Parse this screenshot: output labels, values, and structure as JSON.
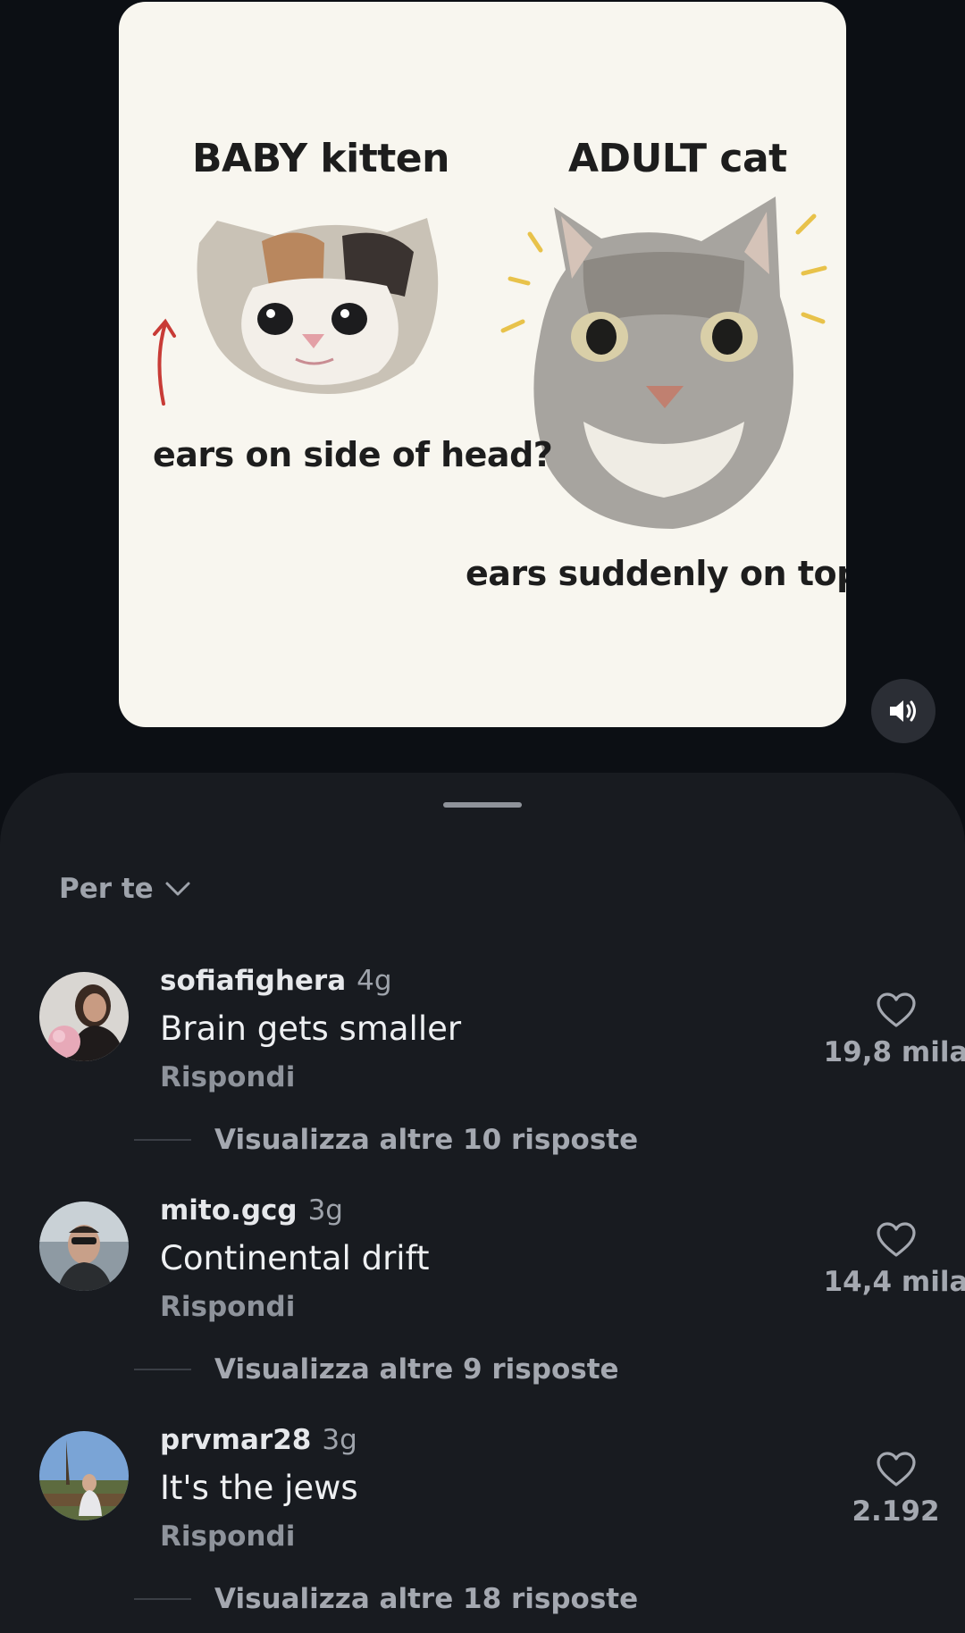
{
  "post": {
    "image_texts": {
      "baby_label": "BABY kitten",
      "adult_label": "ADULT cat",
      "side_caption": "ears on side of head?",
      "top_caption": "ears suddenly on top?.."
    },
    "sound_icon": "speaker-volume-icon"
  },
  "comments_sheet": {
    "sort_label": "Per te",
    "comments": [
      {
        "username": "sofiafighera",
        "time": "4g",
        "text": "Brain gets smaller",
        "reply_label": "Rispondi",
        "likes": "19,8 mila",
        "more_replies": "Visualizza altre 10 risposte"
      },
      {
        "username": "mito.gcg",
        "time": "3g",
        "text": "Continental drift",
        "reply_label": "Rispondi",
        "likes": "14,4 mila",
        "more_replies": "Visualizza altre 9 risposte"
      },
      {
        "username": "prvmar28",
        "time": "3g",
        "text": "It's the jews",
        "reply_label": "Rispondi",
        "likes": "2.192",
        "more_replies": "Visualizza altre 18 risposte"
      }
    ]
  },
  "colors": {
    "background": "#0c0f14",
    "sheet": "#181b20",
    "muted_text": "#9ea3ab"
  }
}
